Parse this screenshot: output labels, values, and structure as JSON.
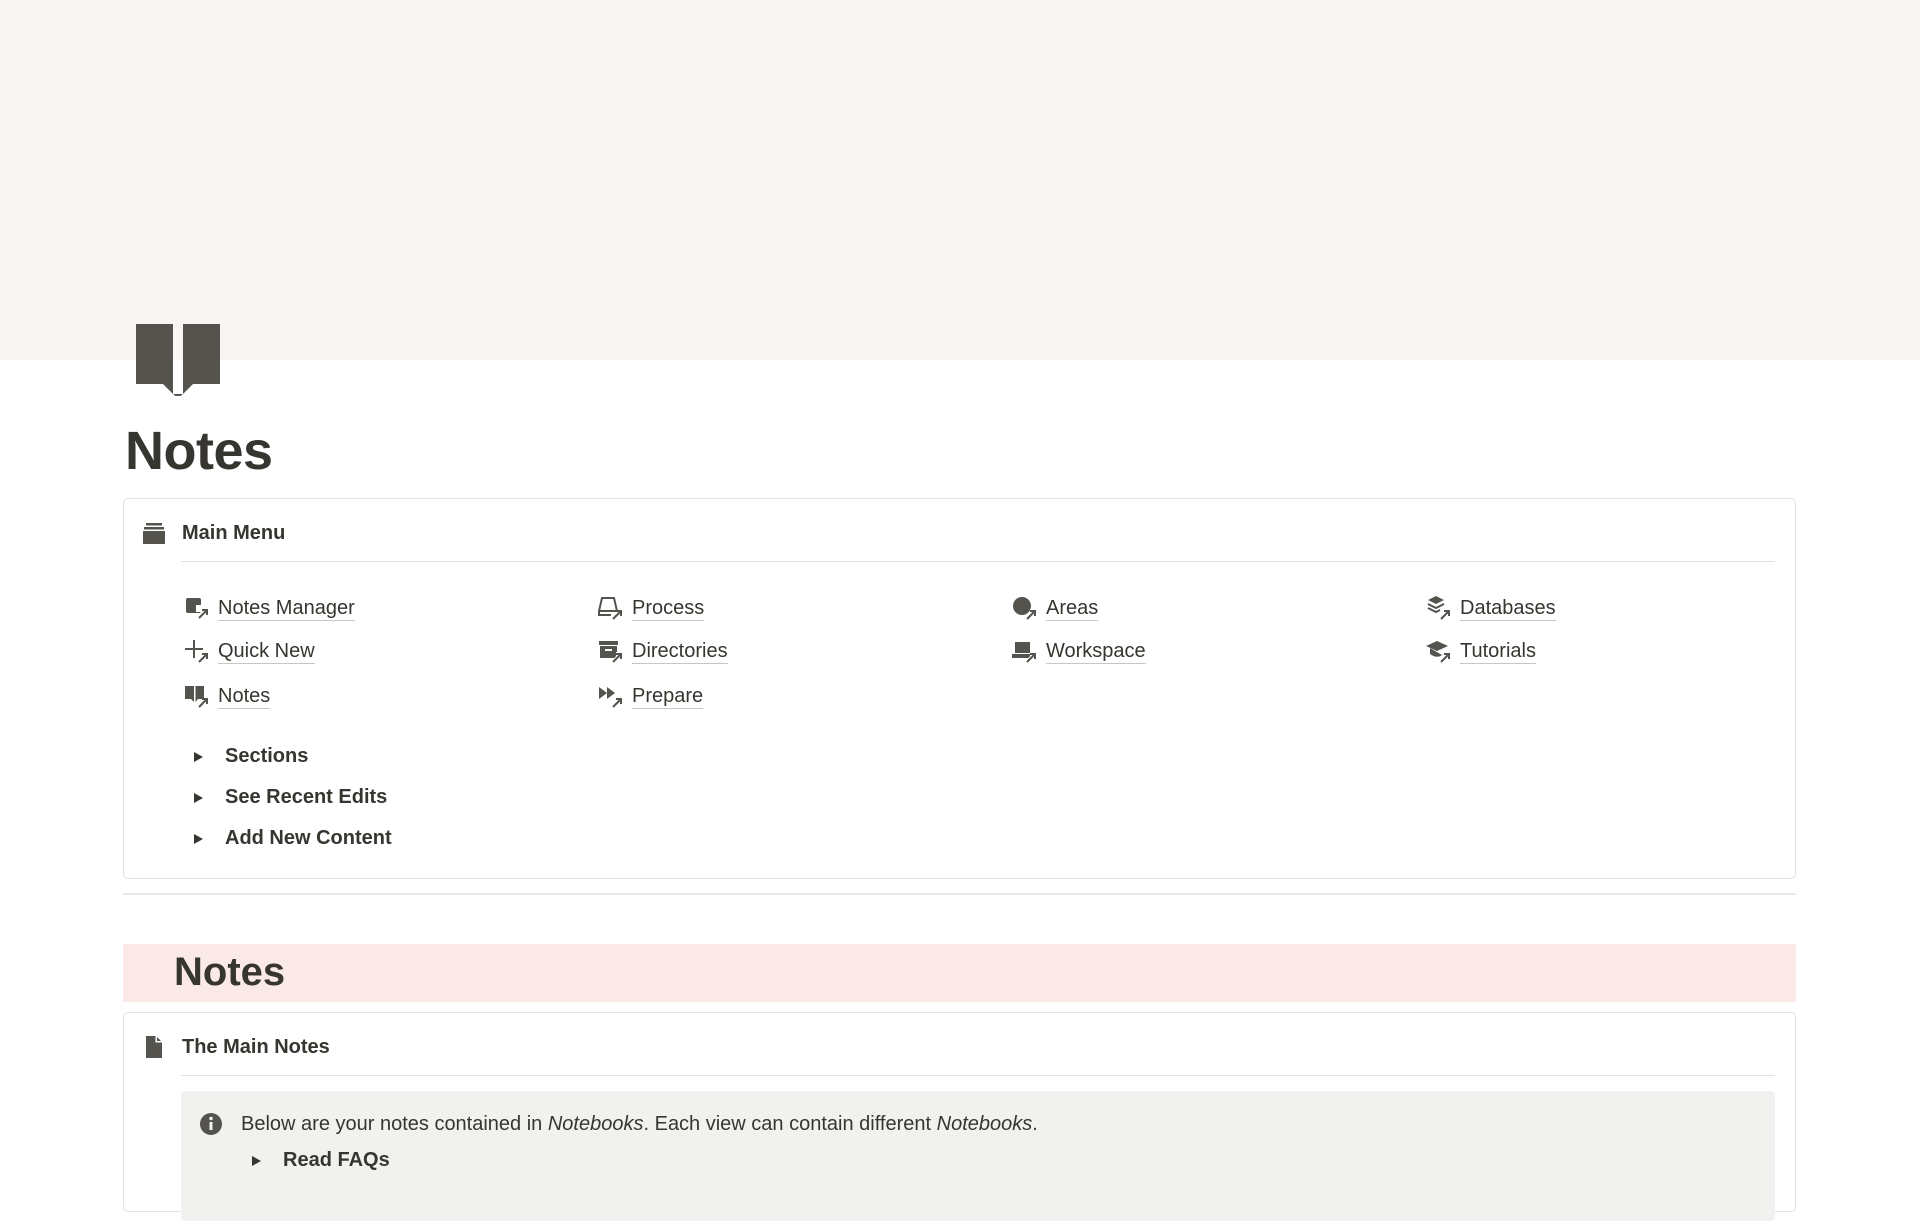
{
  "page": {
    "title": "Notes",
    "icon": "open-book-icon",
    "cover_color": "#f7f6f3"
  },
  "main_menu": {
    "icon": "tray-stack-icon",
    "title": "Main Menu",
    "links": [
      {
        "label": "Notes Manager",
        "icon": "notes-manager-icon"
      },
      {
        "label": "Quick New",
        "icon": "plus-icon"
      },
      {
        "label": "Notes",
        "icon": "open-book-icon"
      },
      {
        "label": "Process",
        "icon": "inbox-tray-icon"
      },
      {
        "label": "Directories",
        "icon": "archive-box-icon"
      },
      {
        "label": "Prepare",
        "icon": "fast-forward-icon"
      },
      {
        "label": "Areas",
        "icon": "circle-icon"
      },
      {
        "label": "Workspace",
        "icon": "laptop-icon"
      },
      {
        "label": "Databases",
        "icon": "layers-icon"
      },
      {
        "label": "Tutorials",
        "icon": "graduation-cap-icon"
      }
    ],
    "toggles": [
      "Sections",
      "See Recent Edits",
      "Add New Content"
    ]
  },
  "notes_section": {
    "heading": "Notes",
    "heading_bg": "#fbe9e8",
    "callout": {
      "icon": "document-icon",
      "title": "The Main Notes",
      "info": {
        "icon": "info-icon",
        "text_1": "Below are your notes contained in ",
        "em_1": "Notebooks",
        "text_2": ". Each view can contain different ",
        "em_2": "Notebooks",
        "text_3": "."
      },
      "toggle": "Read FAQs"
    }
  }
}
